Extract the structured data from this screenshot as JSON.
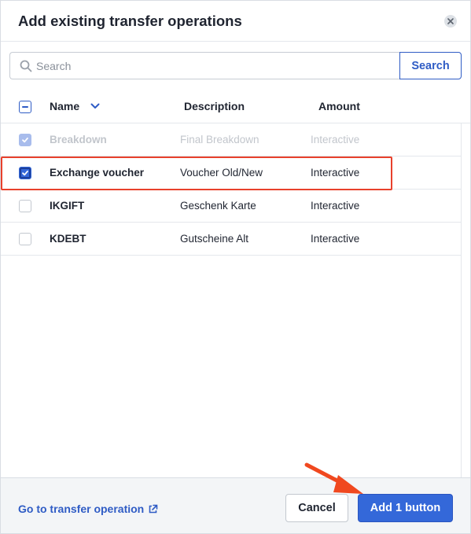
{
  "dialog": {
    "title": "Add existing transfer operations"
  },
  "search": {
    "placeholder": "Search",
    "value": "",
    "button_label": "Search"
  },
  "table": {
    "columns": {
      "name": "Name",
      "description": "Description",
      "amount": "Amount"
    },
    "rows": [
      {
        "name": "Breakdown",
        "description": "Final Breakdown",
        "amount": "Interactive",
        "state": "disabled-checked"
      },
      {
        "name": "Exchange voucher",
        "description": "Voucher Old/New",
        "amount": "Interactive",
        "state": "checked"
      },
      {
        "name": "IKGIFT",
        "description": "Geschenk Karte",
        "amount": "Interactive",
        "state": "unchecked"
      },
      {
        "name": "KDEBT",
        "description": "Gutscheine Alt",
        "amount": "Interactive",
        "state": "unchecked"
      }
    ]
  },
  "footer": {
    "link_label": "Go to transfer operation",
    "cancel_label": "Cancel",
    "add_label": "Add 1 button"
  },
  "colors": {
    "accent": "#3468d9",
    "highlight": "#e8412c",
    "footer_bg": "#f3f5f7"
  },
  "icons": {
    "close": "close-icon",
    "search": "search-icon",
    "sort": "chevron-down-icon",
    "external": "external-link-icon",
    "annotation": "arrow-annotation"
  }
}
